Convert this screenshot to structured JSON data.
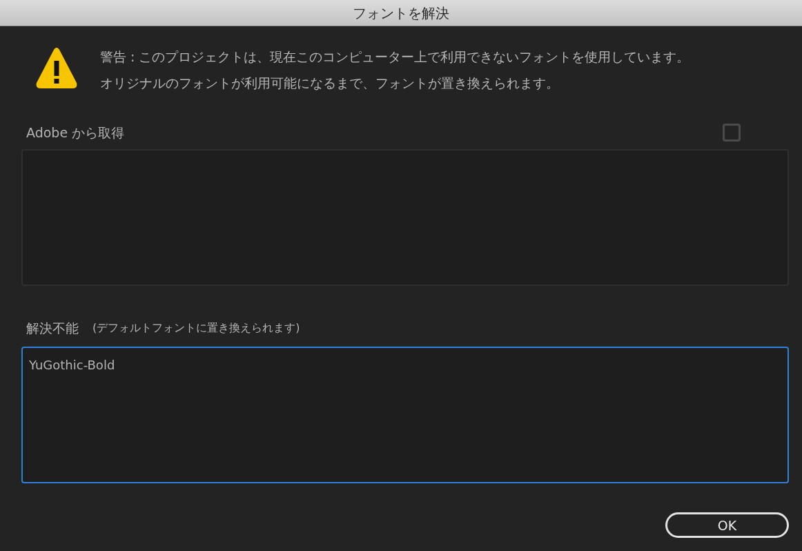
{
  "window": {
    "title": "フォントを解決"
  },
  "warning": {
    "lines": [
      "警告 : このプロジェクトは、現在このコンピューター上で利用できないフォントを使用しています。",
      "オリジナルのフォントが利用可能になるまで、フォントが置き換えられます。"
    ]
  },
  "sections": [
    {
      "label": "Adobe から取得",
      "checkbox": {
        "checked": false
      },
      "focused": false
    },
    {
      "label": "解決不能",
      "note": "(デフォルトフォントに置き換えられます)",
      "focused": true,
      "items": [
        "YuGothic-Bold"
      ]
    }
  ],
  "buttons": [
    {
      "label": "OK"
    }
  ]
}
